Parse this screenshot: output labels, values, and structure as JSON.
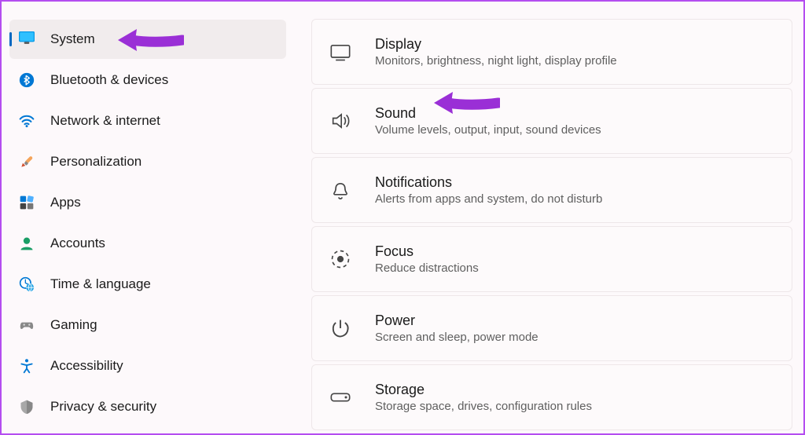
{
  "sidebar": {
    "items": [
      {
        "label": "System",
        "active": true
      },
      {
        "label": "Bluetooth & devices"
      },
      {
        "label": "Network & internet"
      },
      {
        "label": "Personalization"
      },
      {
        "label": "Apps"
      },
      {
        "label": "Accounts"
      },
      {
        "label": "Time & language"
      },
      {
        "label": "Gaming"
      },
      {
        "label": "Accessibility"
      },
      {
        "label": "Privacy & security"
      }
    ]
  },
  "main": {
    "cards": [
      {
        "title": "Display",
        "desc": "Monitors, brightness, night light, display profile"
      },
      {
        "title": "Sound",
        "desc": "Volume levels, output, input, sound devices"
      },
      {
        "title": "Notifications",
        "desc": "Alerts from apps and system, do not disturb"
      },
      {
        "title": "Focus",
        "desc": "Reduce distractions"
      },
      {
        "title": "Power",
        "desc": "Screen and sleep, power mode"
      },
      {
        "title": "Storage",
        "desc": "Storage space, drives, configuration rules"
      }
    ]
  },
  "annotations": {
    "arrow_color": "#9a2fd6"
  }
}
